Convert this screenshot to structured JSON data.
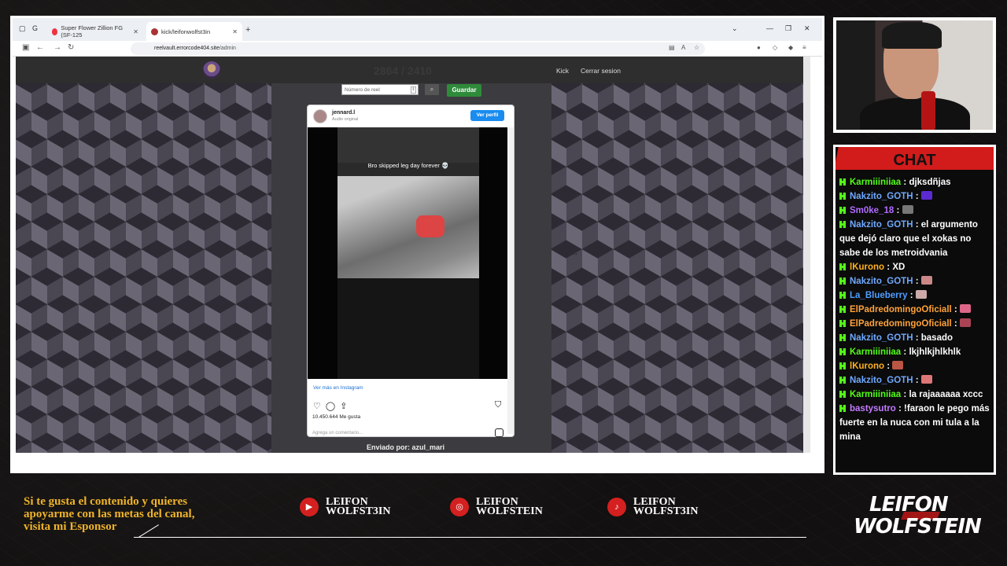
{
  "browser": {
    "tabs": [
      {
        "title": "Super Flower Zillion FG (SF-125",
        "active": false
      },
      {
        "title": "kick/leifonwolfst3in",
        "active": true
      }
    ],
    "url_host": "reelvault.errorcode404.site",
    "url_path": "/admin"
  },
  "site": {
    "ghost_count": "2864 / 2410",
    "nav_links": [
      "Kick",
      "Cerrar sesion"
    ],
    "reel_placeholder": "Número de reel",
    "save_label": "Guardar",
    "sent_by": "Enviado por: azul_mari"
  },
  "instagram": {
    "username": "jennard.l",
    "audio": "Audio original",
    "view_profile": "Ver perfil",
    "caption": "Bro skipped leg day forever 💀",
    "view_more": "Ver más en Instagram",
    "likes": "10.450.644 Me gusta",
    "comment_placeholder": "Agrega un comentario..."
  },
  "chat": {
    "title": "CHAT",
    "messages": [
      {
        "user": "Karmiiiniiaa",
        "color": "#53fc18",
        "text": "djksdñjas"
      },
      {
        "user": "Nakzito_GOTH",
        "color": "#6fa8ff",
        "text": "",
        "emote": "#5b2bd1"
      },
      {
        "user": "Sm0ke_18",
        "color": "#b06bff",
        "text": "",
        "emote": "#777"
      },
      {
        "user": "Nakzito_GOTH",
        "color": "#6fa8ff",
        "text": "el argumento que dejó claro que el xokas no sabe de los metroidvania"
      },
      {
        "user": "lKurono",
        "color": "#ffb020",
        "text": "XD"
      },
      {
        "user": "Nakzito_GOTH",
        "color": "#6fa8ff",
        "text": "",
        "emote": "#c88"
      },
      {
        "user": "La_Blueberry",
        "color": "#4f9dff",
        "text": "",
        "emote": "#caa"
      },
      {
        "user": "ElPadredomingoOficiall",
        "color": "#ffa23a",
        "text": "",
        "emote": "#d68"
      },
      {
        "user": "ElPadredomingoOficiall",
        "color": "#ffa23a",
        "text": "",
        "emote": "#a45"
      },
      {
        "user": "Nakzito_GOTH",
        "color": "#6fa8ff",
        "text": "basado"
      },
      {
        "user": "Karmiiiniiaa",
        "color": "#53fc18",
        "text": "lkjhlkjhlkhlk"
      },
      {
        "user": "lKurono",
        "color": "#ffb020",
        "text": "",
        "emote": "#b54"
      },
      {
        "user": "Nakzito_GOTH",
        "color": "#6fa8ff",
        "text": "",
        "emote": "#d77"
      },
      {
        "user": "Karmiiiniiaa",
        "color": "#53fc18",
        "text": "la rajaaaaaa xccc"
      },
      {
        "user": "bastysutro",
        "color": "#c27bff",
        "text": "!faraon le pego más fuerte en la nuca con mi tula a la mina"
      }
    ]
  },
  "footer": {
    "sponsor_text": [
      "Si te gusta el contenido y quieres",
      "apoyarme con las metas del canal,",
      "visita mi Esponsor"
    ],
    "socials": [
      {
        "icon": "youtube-icon",
        "glyph": "▶",
        "line1": "LEIFON",
        "line2": "WOLFST3IN"
      },
      {
        "icon": "instagram-icon",
        "glyph": "◎",
        "line1": "LEIFON",
        "line2": "WOLFSTEIN"
      },
      {
        "icon": "tiktok-icon",
        "glyph": "♪",
        "line1": "LEIFON",
        "line2": "WOLFST3IN"
      }
    ],
    "brand_top": "LEIFON",
    "brand_bottom": "WOLFSTEIN"
  }
}
